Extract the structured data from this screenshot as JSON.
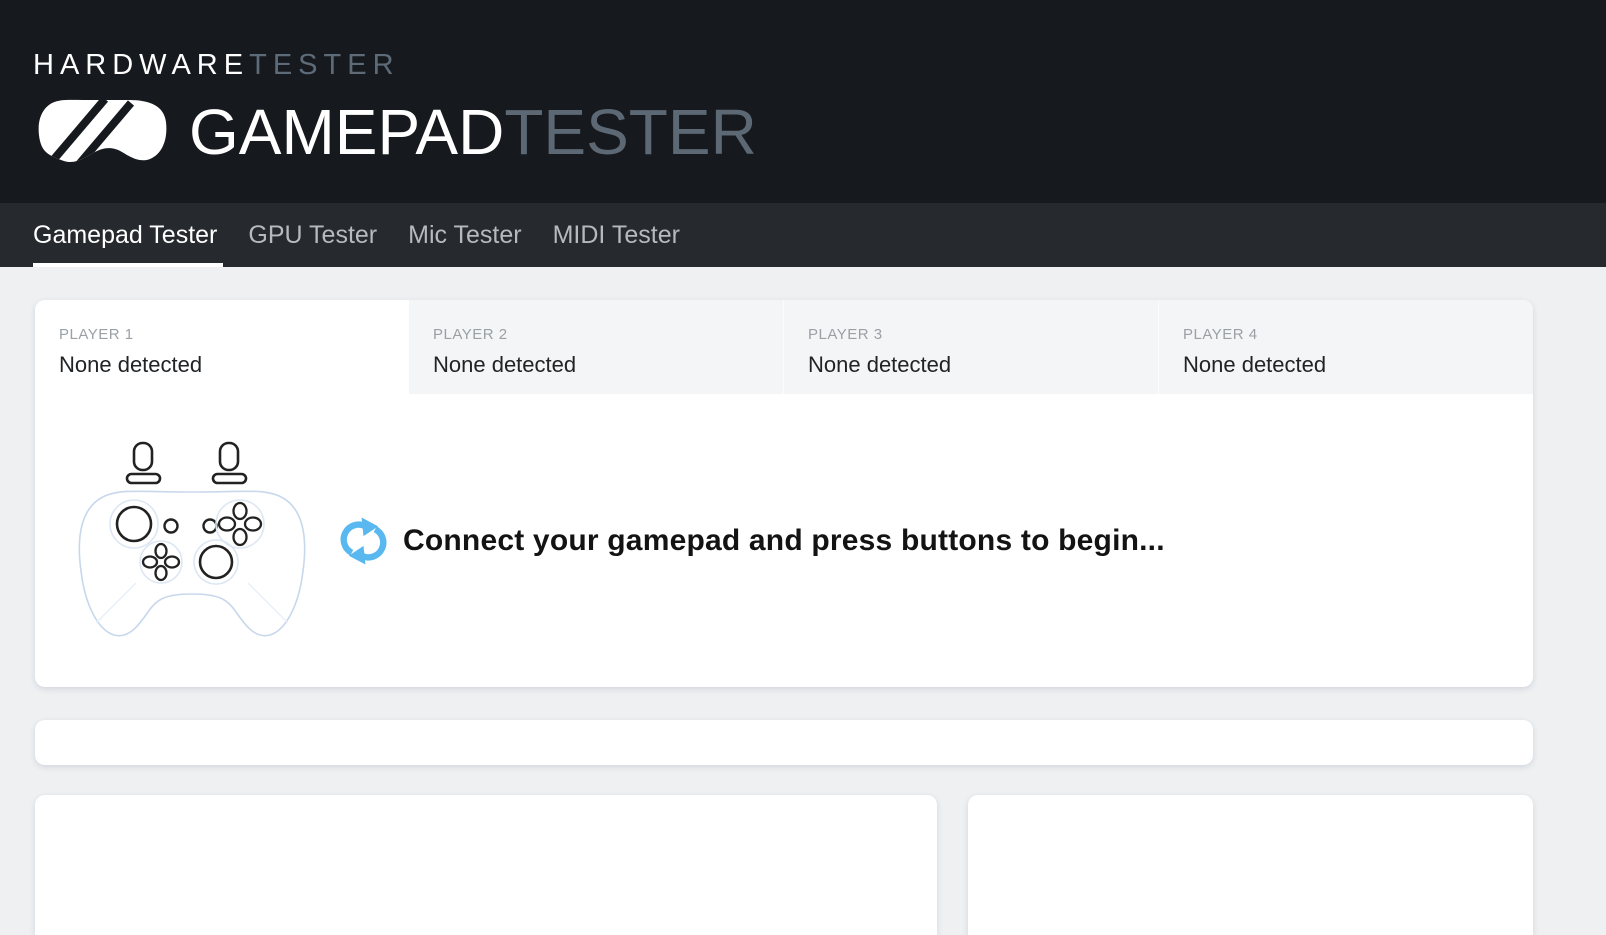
{
  "header": {
    "site_name_primary": "HARDWARE",
    "site_name_secondary": "TESTER",
    "page_title_primary": "GAMEPAD",
    "page_title_secondary": "TESTER"
  },
  "nav": {
    "items": [
      {
        "label": "Gamepad Tester",
        "active": true
      },
      {
        "label": "GPU Tester",
        "active": false
      },
      {
        "label": "Mic Tester",
        "active": false
      },
      {
        "label": "MIDI Tester",
        "active": false
      }
    ]
  },
  "players": [
    {
      "label": "PLAYER 1",
      "status": "None detected",
      "active": true
    },
    {
      "label": "PLAYER 2",
      "status": "None detected",
      "active": false
    },
    {
      "label": "PLAYER 3",
      "status": "None detected",
      "active": false
    },
    {
      "label": "PLAYER 4",
      "status": "None detected",
      "active": false
    }
  ],
  "main": {
    "message": "Connect your gamepad and press buttons to begin..."
  },
  "icons": {
    "brand_logo": "gamepad-logo-icon",
    "status": "refresh-icon",
    "illustration": "gamepad-outline-illustration"
  },
  "colors": {
    "header_bg": "#16191d",
    "nav_bg": "#26292e",
    "page_bg": "#eef0f2",
    "inactive_tab_bg": "#f4f5f6",
    "accent_blue": "#58b8ef",
    "muted_slate": "#5c6873"
  }
}
